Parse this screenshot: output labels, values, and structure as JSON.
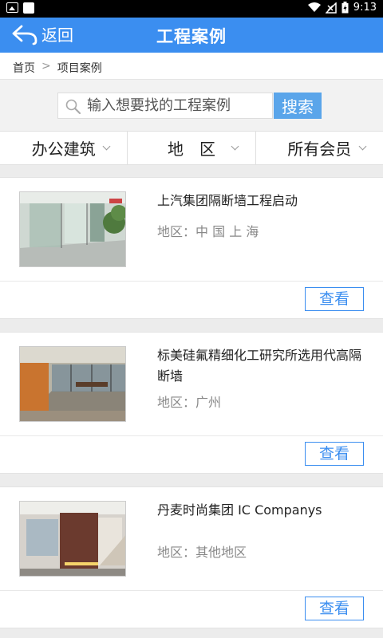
{
  "status_bar": {
    "time": "9:13",
    "icons": [
      "image-icon",
      "notification-square-icon",
      "wifi-icon",
      "no-signal-icon",
      "battery-icon"
    ]
  },
  "app_bar": {
    "back_label": "返回",
    "title": "工程案例",
    "accent_color": "#3b8ef0"
  },
  "breadcrumb": {
    "home": "首页",
    "separator": ">",
    "current": "项目案例"
  },
  "search": {
    "placeholder": "输入想要找的工程案例",
    "button_label": "搜索"
  },
  "filters": [
    {
      "label": "办公建筑"
    },
    {
      "label": "地　区"
    },
    {
      "label": "所有会员"
    }
  ],
  "region_label": "地区：",
  "view_label": "查看",
  "cases": [
    {
      "title": "上汽集团隔断墙工程启动",
      "region": "中 国 上 海"
    },
    {
      "title": "标美硅氟精细化工研究所选用代高隔断墙",
      "region": "广州"
    },
    {
      "title": "丹麦时尚集团 IC Companys",
      "region": "其他地区"
    }
  ]
}
